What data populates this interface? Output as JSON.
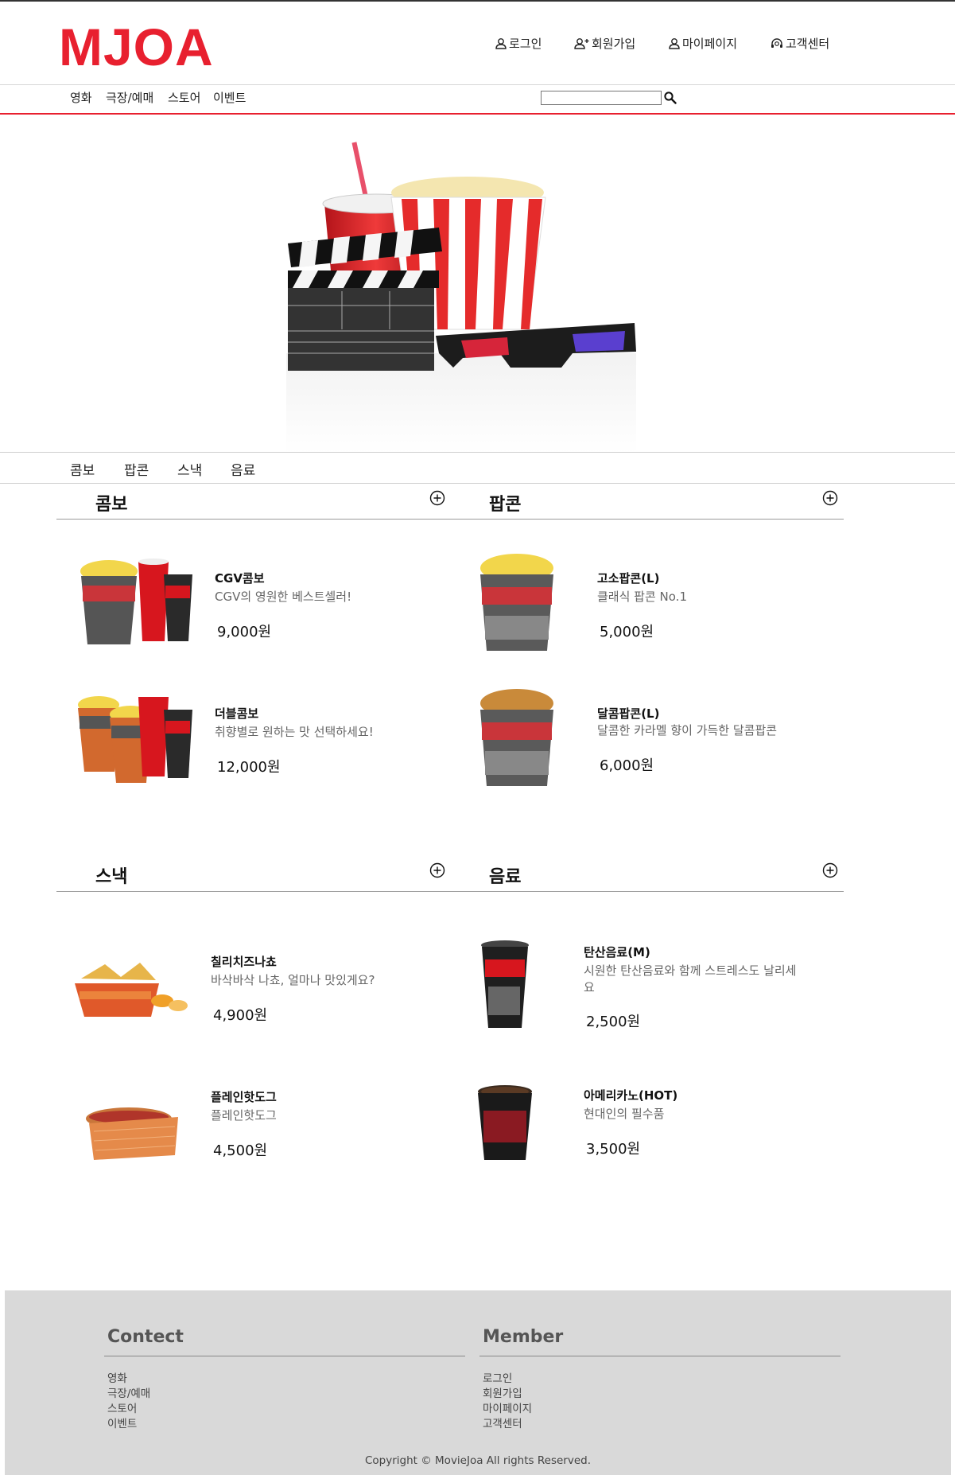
{
  "brand": {
    "logo_text": "MJOA",
    "logo_color": "#e8202f"
  },
  "util_nav": [
    {
      "label": "로그인",
      "icon": "user-icon"
    },
    {
      "label": "회원가입",
      "icon": "user-plus-icon"
    },
    {
      "label": "마이페이지",
      "icon": "user-icon"
    },
    {
      "label": "고객센터",
      "icon": "headset-icon"
    }
  ],
  "gnb": [
    "영화",
    "극장/예매",
    "스토어",
    "이벤트"
  ],
  "search": {
    "value": "",
    "placeholder": ""
  },
  "hero": {
    "image": "popcorn-drink-clapperboard-3d-glasses"
  },
  "store_tabs": [
    "콤보",
    "팝콘",
    "스낵",
    "음료"
  ],
  "sections": [
    {
      "title": "콤보",
      "items": [
        {
          "name": "CGV콤보",
          "desc": "CGV의 영원한 베스트셀러!",
          "price": "9,000원"
        },
        {
          "name": "더블콤보",
          "desc": "취향별로 원하는 맛 선택하세요!",
          "price": "12,000원"
        }
      ]
    },
    {
      "title": "팝콘",
      "items": [
        {
          "name": "고소팝콘(L)",
          "desc": "클래식 팝콘 No.1",
          "price": "5,000원"
        },
        {
          "name": "달콤팝콘(L)",
          "desc": "달콤한 카라멜 향이 가득한 달콤팝콘",
          "price": "6,000원"
        }
      ]
    },
    {
      "title": "스낵",
      "items": [
        {
          "name": "칠리치즈나쵸",
          "desc": "바삭바삭 나쵸, 얼마나 맛있게요?",
          "price": "4,900원"
        },
        {
          "name": "플레인핫도그",
          "desc": "플레인핫도그",
          "price": "4,500원"
        }
      ]
    },
    {
      "title": "음료",
      "items": [
        {
          "name": "탄산음료(M)",
          "desc": "시원한 탄산음료와 함께 스트레스도 날리세요",
          "price": "2,500원"
        },
        {
          "name": "아메리카노(HOT)",
          "desc": "현대인의 필수품",
          "price": "3,500원"
        }
      ]
    }
  ],
  "footer": {
    "contact_title": "Contect",
    "contact_links": [
      "영화",
      "극장/예매",
      "스토어",
      "이벤트"
    ],
    "member_title": "Member",
    "member_links": [
      "로그인",
      "회원가입",
      "마이페이지",
      "고객센터"
    ],
    "copyright": "Copyright © MovieJoa All rights Reserved."
  },
  "colors": {
    "accent": "#e8202f",
    "footer_bg": "#d9d9d9",
    "cgv_red": "#d7161e"
  }
}
